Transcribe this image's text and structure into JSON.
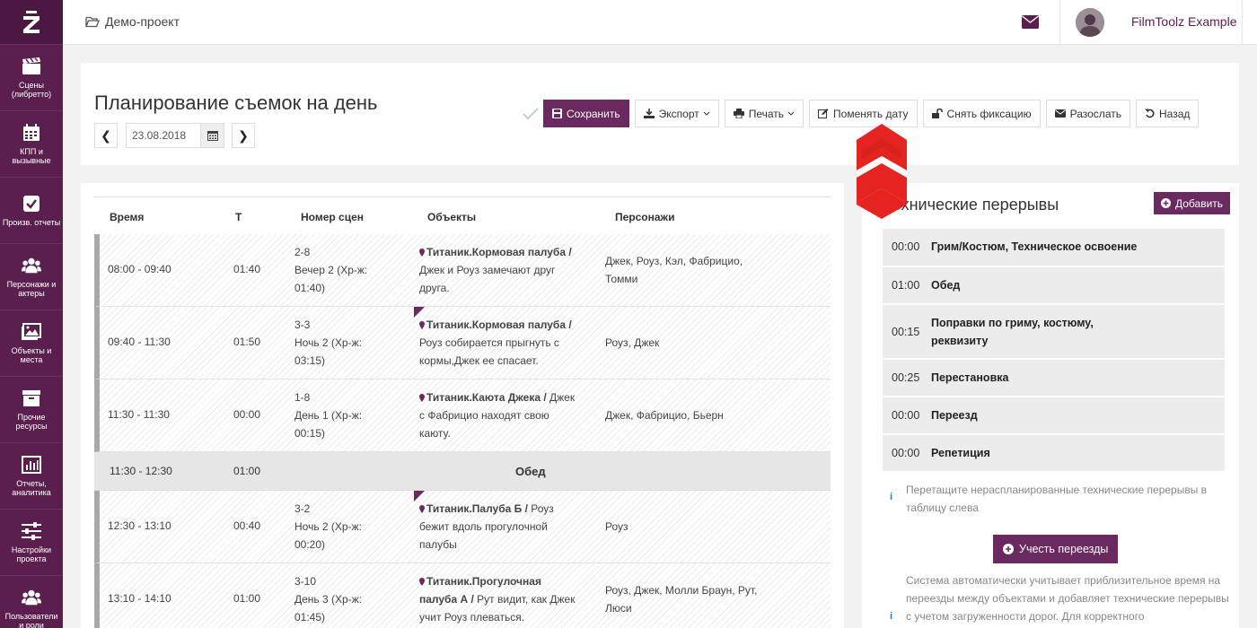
{
  "app": {
    "logo_letter": "Z"
  },
  "sidebar": {
    "items": [
      {
        "label": "Сцены (либретто)",
        "icon": "clapperboard-icon"
      },
      {
        "label": "КПП и вызывные",
        "icon": "calendar-icon"
      },
      {
        "label": "Произв. отчеты",
        "icon": "checkbox-icon"
      },
      {
        "label": "Персонажи и актеры",
        "icon": "users-icon"
      },
      {
        "label": "Объекты и места",
        "icon": "image-icon"
      },
      {
        "label": "Прочие ресурсы",
        "icon": "archive-icon"
      },
      {
        "label": "Отчеты, аналитика",
        "icon": "bar-chart-icon"
      },
      {
        "label": "Настройки проекта",
        "icon": "sliders-icon"
      },
      {
        "label": "Пользователи и роли",
        "icon": "users-icon"
      }
    ]
  },
  "topbar": {
    "project": "Демо-проект",
    "user": "FilmToolz Example"
  },
  "header": {
    "title": "Планирование съемок на день",
    "date": "23.08.2018",
    "prev": "❮",
    "next": "❯",
    "buttons": {
      "save": "Сохранить",
      "export": "Экспорт",
      "print": "Печать",
      "change_date": "Поменять дату",
      "unfix": "Снять фиксацию",
      "send": "Разослать",
      "back": "Назад"
    }
  },
  "schedule": {
    "columns": [
      "Время",
      "Т",
      "Номер сцен",
      "Объекты",
      "Персонажи"
    ],
    "rows": [
      {
        "time": "08:00 - 09:40",
        "t": "01:40",
        "scene1": "2-8",
        "scene2": "Вечер 2 (Хр-ж:",
        "scene3": "01:40)",
        "obj_bold": "Титаник.Кормовая палуба /",
        "obj_text": "Джек и Роуз замечают друг друга.",
        "persons": "Джек, Роуз, Кэл, Фабрицио, Томми"
      },
      {
        "time": "09:40 - 11:30",
        "t": "01:50",
        "scene1": "3-3",
        "scene2": "Ночь 2 (Хр-ж:",
        "scene3": "03:15)",
        "obj_bold": "Титаник.Кормовая палуба /",
        "obj_text": "Роуз собирается прыгнуть с кормы,Джек ее спасает.",
        "persons": "Роуз, Джек"
      },
      {
        "time": "11:30 - 11:30",
        "t": "00:00",
        "scene1": "1-8",
        "scene2": "День 1 (Хр-ж:",
        "scene3": "00:15)",
        "obj_bold": "Титаник.Каюта Джека /",
        "obj_text": "Джек с Фабрицио находят свою каюту.",
        "persons": "Джек, Фабрицио, Бьерн"
      },
      {
        "time": "12:30 - 13:10",
        "t": "00:40",
        "scene1": "3-2",
        "scene2": "Ночь 2 (Хр-ж:",
        "scene3": "00:20)",
        "obj_bold": "Титаник.Палуба Б /",
        "obj_text": "Роуз бежит вдоль прогулочной палубы",
        "persons": "Роуз"
      },
      {
        "time": "13:10 - 14:10",
        "t": "01:00",
        "scene1": "3-10",
        "scene2": "День 3 (Хр-ж:",
        "scene3": "01:45)",
        "obj_bold": "Титаник.Прогулочная палуба А /",
        "obj_text": "Рут видит, как Джек учит Роуз плеваться.",
        "persons": "Роуз, Джек, Молли Браун, Рут, Люси"
      }
    ],
    "lunch": {
      "time": "11:30 - 12:30",
      "t": "01:00",
      "label": "Обед"
    }
  },
  "breaks": {
    "title": "Технические перерывы",
    "add": "Добавить",
    "items": [
      {
        "time": "00:00",
        "name": "Грим/Костюм, Техническое освоение"
      },
      {
        "time": "01:00",
        "name": "Обед"
      },
      {
        "time": "00:15",
        "name": "Поправки по гриму, костюму, реквизиту"
      },
      {
        "time": "00:25",
        "name": "Перестановка"
      },
      {
        "time": "00:00",
        "name": "Переезд"
      },
      {
        "time": "00:00",
        "name": "Репетиция"
      }
    ],
    "hint1": "Перетащите нераспланированные технические перерывы в таблицу слева",
    "accept": "Учесть переезды",
    "hint2": "Система автоматически учитывает приблизительное время на переезды между объектами и добавляет технические перерывы с учетом загруженности дорог. Для корректного"
  },
  "colors": {
    "brand": "#5a1f4f",
    "accent": "#6b2a5f",
    "arrow": "#e52421"
  }
}
